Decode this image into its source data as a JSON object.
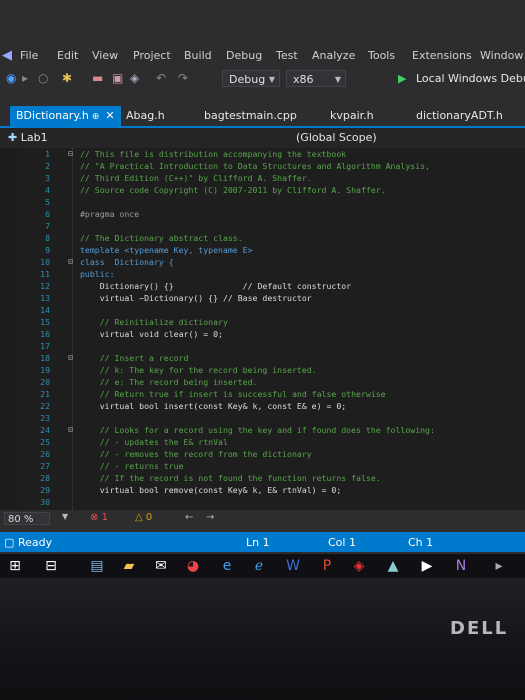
{
  "menubar": {
    "items": [
      "File",
      "Edit",
      "View",
      "Project",
      "Build",
      "Debug",
      "Test",
      "Analyze",
      "Tools",
      "Extensions",
      "Window"
    ]
  },
  "toolbar": {
    "configuration": "Debug",
    "platform": "x86",
    "run_label": "Local Windows Debug"
  },
  "tabs": [
    {
      "label": "BDictionary.h",
      "active": true
    },
    {
      "label": "Abag.h",
      "active": false
    },
    {
      "label": "bagtestmain.cpp",
      "active": false
    },
    {
      "label": "kvpair.h",
      "active": false
    },
    {
      "label": "dictionaryADT.h",
      "active": false
    }
  ],
  "navbar": {
    "project": "Lab1",
    "scope": "(Global Scope)"
  },
  "code": {
    "lines": [
      {
        "n": "1",
        "text": "// This file is distribution accompanying the textbook",
        "cls": "c",
        "fold": "⊟"
      },
      {
        "n": "2",
        "text": "// \"A Practical Introduction to Data Structures and Algorithm Analysis,",
        "cls": "c",
        "fold": ""
      },
      {
        "n": "3",
        "text": "// Third Edition (C++)\" by Clifford A. Shaffer.",
        "cls": "c",
        "fold": ""
      },
      {
        "n": "4",
        "text": "// Source code Copyright (C) 2007-2011 by Clifford A. Shaffer.",
        "cls": "c",
        "fold": ""
      },
      {
        "n": "5",
        "text": "",
        "cls": "d",
        "fold": ""
      },
      {
        "n": "6",
        "text": "#pragma once",
        "cls": "p",
        "fold": ""
      },
      {
        "n": "7",
        "text": "",
        "cls": "d",
        "fold": ""
      },
      {
        "n": "8",
        "text": "// The Dictionary abstract class.",
        "cls": "c",
        "fold": ""
      },
      {
        "n": "9",
        "text": "template <typename Key, typename E>",
        "cls": "k",
        "fold": ""
      },
      {
        "n": "10",
        "text": "class  Dictionary {",
        "cls": "k",
        "fold": "⊟"
      },
      {
        "n": "11",
        "text": "public:",
        "cls": "k",
        "fold": ""
      },
      {
        "n": "12",
        "text": "    Dictionary() {}              // Default constructor",
        "cls": "d",
        "fold": ""
      },
      {
        "n": "13",
        "text": "    virtual ~Dictionary() {} // Base destructor",
        "cls": "d",
        "fold": ""
      },
      {
        "n": "14",
        "text": "",
        "cls": "d",
        "fold": ""
      },
      {
        "n": "15",
        "text": "    // Reinitialize dictionary",
        "cls": "c",
        "fold": ""
      },
      {
        "n": "16",
        "text": "    virtual void clear() = 0;",
        "cls": "d",
        "fold": ""
      },
      {
        "n": "17",
        "text": "",
        "cls": "d",
        "fold": ""
      },
      {
        "n": "18",
        "text": "    // Insert a record",
        "cls": "c",
        "fold": "⊟"
      },
      {
        "n": "19",
        "text": "    // k: The key for the record being inserted.",
        "cls": "c",
        "fold": ""
      },
      {
        "n": "20",
        "text": "    // e: The record being inserted.",
        "cls": "c",
        "fold": ""
      },
      {
        "n": "21",
        "text": "    // Return true if insert is successful and false otherwise",
        "cls": "c",
        "fold": ""
      },
      {
        "n": "22",
        "text": "    virtual bool insert(const Key& k, const E& e) = 0;",
        "cls": "d",
        "fold": ""
      },
      {
        "n": "23",
        "text": "",
        "cls": "d",
        "fold": ""
      },
      {
        "n": "24",
        "text": "    // Looks for a record using the key and if found does the following:",
        "cls": "c",
        "fold": "⊟"
      },
      {
        "n": "25",
        "text": "    // - updates the E& rtnVal",
        "cls": "c",
        "fold": ""
      },
      {
        "n": "26",
        "text": "    // - removes the record from the dictionary",
        "cls": "c",
        "fold": ""
      },
      {
        "n": "27",
        "text": "    // - returns true",
        "cls": "c",
        "fold": ""
      },
      {
        "n": "28",
        "text": "    // If the record is not found the function returns false.",
        "cls": "c",
        "fold": ""
      },
      {
        "n": "29",
        "text": "    virtual bool remove(const Key& k, E& rtnVal) = 0;",
        "cls": "d",
        "fold": ""
      },
      {
        "n": "30",
        "text": "",
        "cls": "d",
        "fold": ""
      }
    ]
  },
  "editor_footer": {
    "zoom": "80 %",
    "errors": "1",
    "warnings": "0"
  },
  "statusbar": {
    "state": "Ready",
    "line": "Ln 1",
    "col": "Col 1",
    "ch": "Ch 1"
  },
  "brand": "DELL",
  "colors": {
    "accent": "#007acc",
    "comment": "#57a64a",
    "keyword": "#569cd6",
    "type": "#4ec9b0",
    "linenumber": "#2b91af",
    "editor_bg": "#1e1e1e"
  }
}
